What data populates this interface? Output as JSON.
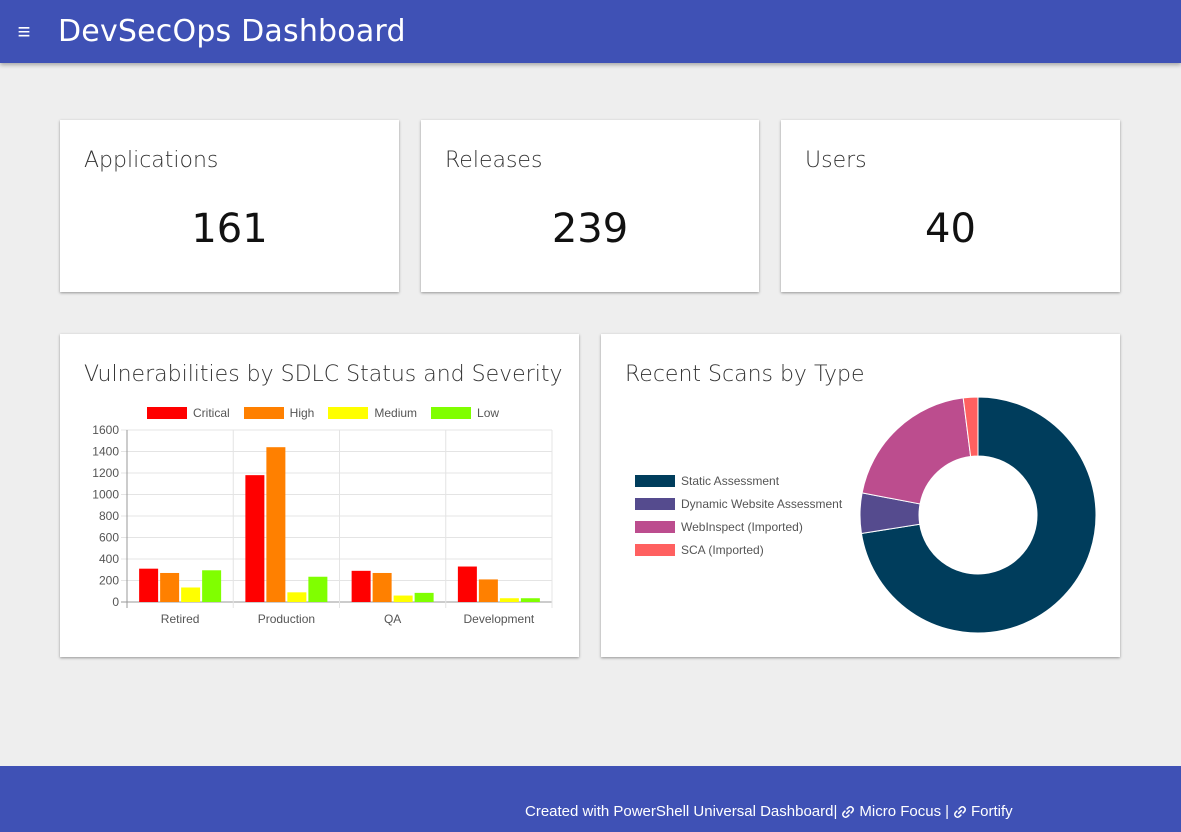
{
  "header": {
    "title": "DevSecOps Dashboard",
    "menu_icon": "≡"
  },
  "stats": [
    {
      "title": "Applications",
      "value": "161"
    },
    {
      "title": "Releases",
      "value": "239"
    },
    {
      "title": "Users",
      "value": "40"
    }
  ],
  "vuln_chart": {
    "title": "Vulnerabilities by SDLC Status and Severity"
  },
  "scan_chart": {
    "title": "Recent Scans by Type"
  },
  "chart_data": [
    {
      "type": "bar",
      "title": "Vulnerabilities by SDLC Status and Severity",
      "categories": [
        "Retired",
        "Production",
        "QA",
        "Development"
      ],
      "series": [
        {
          "name": "Critical",
          "color": "#ff0000",
          "values": [
            310,
            1180,
            290,
            330
          ]
        },
        {
          "name": "High",
          "color": "#ff8000",
          "values": [
            270,
            1440,
            270,
            210
          ]
        },
        {
          "name": "Medium",
          "color": "#ffff00",
          "values": [
            135,
            90,
            60,
            35
          ]
        },
        {
          "name": "Low",
          "color": "#80ff00",
          "values": [
            295,
            235,
            85,
            35
          ]
        }
      ],
      "ylim": [
        0,
        1600
      ],
      "yticks": [
        0,
        200,
        400,
        600,
        800,
        1000,
        1200,
        1400,
        1600
      ],
      "grid": true,
      "legend": "top"
    },
    {
      "type": "pie",
      "title": "Recent Scans by Type",
      "donut": true,
      "labels": [
        "Static Assessment",
        "Dynamic Website Assessment",
        "WebInspect (Imported)",
        "SCA (Imported)"
      ],
      "values": [
        72.5,
        5.5,
        20,
        2
      ],
      "colors": [
        "#003d5c",
        "#554b8e",
        "#bc4d8e",
        "#ff6060"
      ],
      "legend": "left"
    }
  ],
  "footer": {
    "text": "Created with PowerShell Universal Dashboard|",
    "link1": "Micro Focus",
    "separator": "|",
    "link2": "Fortify"
  }
}
